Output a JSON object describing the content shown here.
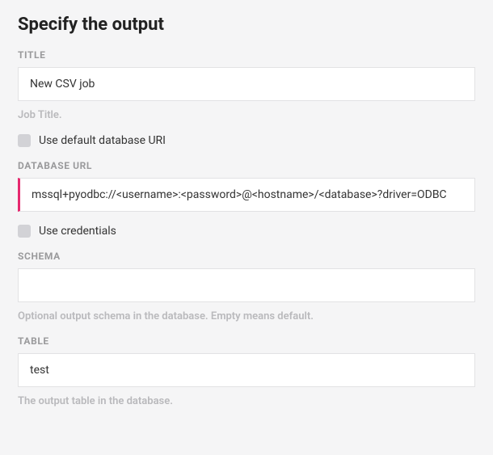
{
  "title": "Specify the output",
  "fields": {
    "title": {
      "label": "TITLE",
      "value": "New CSV job",
      "help": "Job Title."
    },
    "useDefaultUri": {
      "label": "Use default database URI",
      "checked": false
    },
    "databaseUrl": {
      "label": "DATABASE URL",
      "value": "mssql+pyodbc://<username>:<password>@<hostname>/<database>?driver=ODBC"
    },
    "useCredentials": {
      "label": "Use credentials",
      "checked": false
    },
    "schema": {
      "label": "SCHEMA",
      "value": "",
      "help": "Optional output schema in the database. Empty means default."
    },
    "table": {
      "label": "TABLE",
      "value": "test",
      "help": "The output table in the database."
    }
  }
}
